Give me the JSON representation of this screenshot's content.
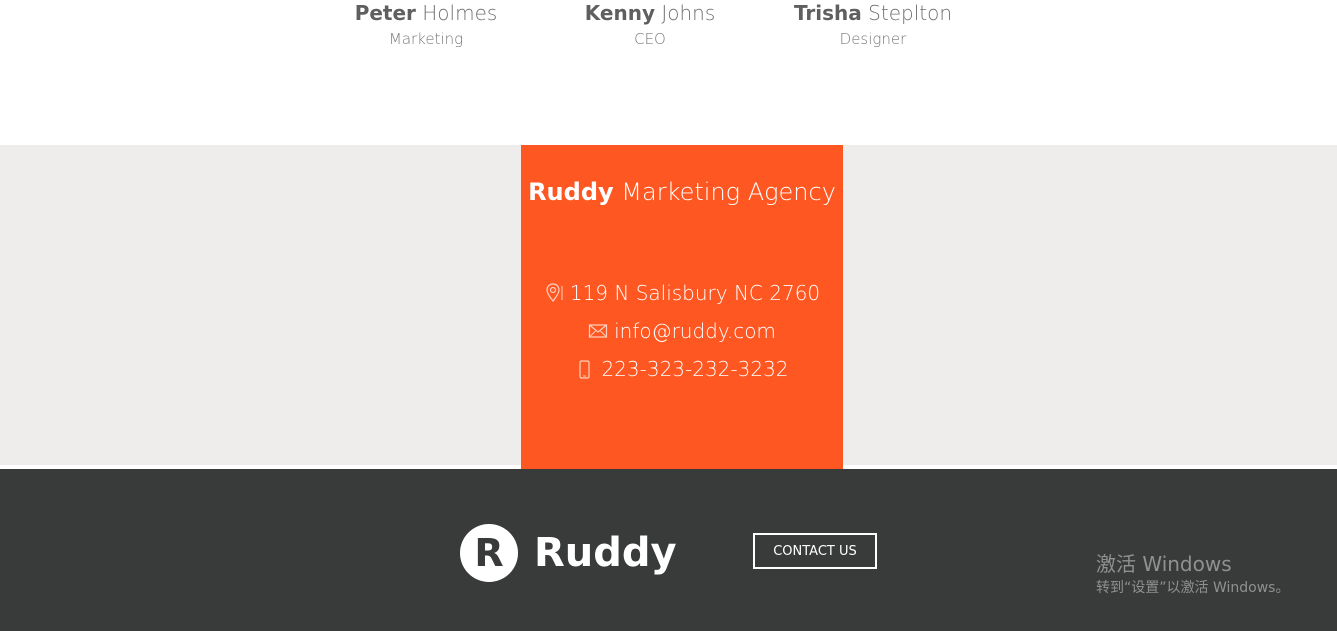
{
  "team": {
    "members": [
      {
        "first": "Peter",
        "last": "Holmes",
        "role": "Marketing"
      },
      {
        "first": "Kenny",
        "last": "Johns",
        "role": "CEO"
      },
      {
        "first": "Trisha",
        "last": "Steplton",
        "role": "Designer"
      }
    ]
  },
  "contact": {
    "brand": "Ruddy",
    "title_rest": "Marketing Agency",
    "address": "119 N Salisbury NC 2760",
    "email": "info@ruddy.com",
    "phone": "223-323-232-3232",
    "icons": {
      "address": "location-pin-icon",
      "email": "envelope-icon",
      "phone": "mobile-phone-icon"
    },
    "accent_color": "#ff5722"
  },
  "footer": {
    "logo_letter": "R",
    "logo_text": "Ruddy",
    "contact_button": "CONTACT US",
    "background": "#393b3b"
  },
  "watermark": {
    "title": "激活 Windows",
    "subtitle": "转到“设置”以激活 Windows。"
  }
}
